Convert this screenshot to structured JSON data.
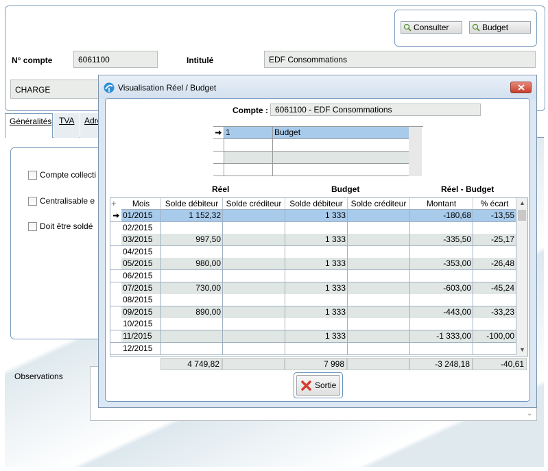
{
  "toolbar": {
    "consulter_label": "Consulter",
    "budget_label": "Budget"
  },
  "account": {
    "num_label": "N° compte",
    "num_value": "6061100",
    "intitule_label": "Intitulé",
    "intitule_value": "EDF Consommations",
    "category_value": "CHARGE"
  },
  "tabs": [
    {
      "label": "Généralités"
    },
    {
      "label": "TVA"
    },
    {
      "label": "Adre"
    }
  ],
  "checkboxes": [
    {
      "label": "Compte collecti"
    },
    {
      "label": "Centralisable e"
    },
    {
      "label": "Doit être soldé"
    }
  ],
  "observations_label": "Observations",
  "dialog": {
    "title": "Visualisation Réel / Budget",
    "compte_label": "Compte :",
    "compte_value": "6061100 - EDF Consommations",
    "budget_list": [
      {
        "num": "1",
        "name": "Budget"
      },
      {
        "num": "",
        "name": ""
      },
      {
        "num": "",
        "name": ""
      },
      {
        "num": "",
        "name": ""
      }
    ],
    "groups": {
      "reel": "Réel",
      "budget": "Budget",
      "ecart": "Réel - Budget"
    },
    "columns": {
      "mois": "Mois",
      "reel_debit": "Solde débiteur",
      "reel_credit": "Solde créditeur",
      "budget_debit": "Solde débiteur",
      "budget_credit": "Solde créditeur",
      "montant": "Montant",
      "pct": "% écart"
    },
    "rows": [
      {
        "mois": "01/2015",
        "reel_debit": "1 152,32",
        "reel_credit": "",
        "budget_debit": "1 333",
        "budget_credit": "",
        "montant": "-180,68",
        "pct": "-13,55"
      },
      {
        "mois": "02/2015",
        "reel_debit": "",
        "reel_credit": "",
        "budget_debit": "",
        "budget_credit": "",
        "montant": "",
        "pct": ""
      },
      {
        "mois": "03/2015",
        "reel_debit": "997,50",
        "reel_credit": "",
        "budget_debit": "1 333",
        "budget_credit": "",
        "montant": "-335,50",
        "pct": "-25,17"
      },
      {
        "mois": "04/2015",
        "reel_debit": "",
        "reel_credit": "",
        "budget_debit": "",
        "budget_credit": "",
        "montant": "",
        "pct": ""
      },
      {
        "mois": "05/2015",
        "reel_debit": "980,00",
        "reel_credit": "",
        "budget_debit": "1 333",
        "budget_credit": "",
        "montant": "-353,00",
        "pct": "-26,48"
      },
      {
        "mois": "06/2015",
        "reel_debit": "",
        "reel_credit": "",
        "budget_debit": "",
        "budget_credit": "",
        "montant": "",
        "pct": ""
      },
      {
        "mois": "07/2015",
        "reel_debit": "730,00",
        "reel_credit": "",
        "budget_debit": "1 333",
        "budget_credit": "",
        "montant": "-603,00",
        "pct": "-45,24"
      },
      {
        "mois": "08/2015",
        "reel_debit": "",
        "reel_credit": "",
        "budget_debit": "",
        "budget_credit": "",
        "montant": "",
        "pct": ""
      },
      {
        "mois": "09/2015",
        "reel_debit": "890,00",
        "reel_credit": "",
        "budget_debit": "1 333",
        "budget_credit": "",
        "montant": "-443,00",
        "pct": "-33,23"
      },
      {
        "mois": "10/2015",
        "reel_debit": "",
        "reel_credit": "",
        "budget_debit": "",
        "budget_credit": "",
        "montant": "",
        "pct": ""
      },
      {
        "mois": "11/2015",
        "reel_debit": "",
        "reel_credit": "",
        "budget_debit": "1 333",
        "budget_credit": "",
        "montant": "-1 333,00",
        "pct": "-100,00"
      },
      {
        "mois": "12/2015",
        "reel_debit": "",
        "reel_credit": "",
        "budget_debit": "",
        "budget_credit": "",
        "montant": "",
        "pct": ""
      }
    ],
    "totals": {
      "reel_debit": "4 749,82",
      "reel_credit": "",
      "budget_debit": "7 998",
      "budget_credit": "",
      "montant": "-3 248,18",
      "pct": "-40,61"
    },
    "sortie_label": "Sortie"
  },
  "colors": {
    "accent": "#7d9ec0",
    "selected_row": "#a9cbeb",
    "shaded_row": "#dfe6e3",
    "close_button": "#d9503a"
  }
}
